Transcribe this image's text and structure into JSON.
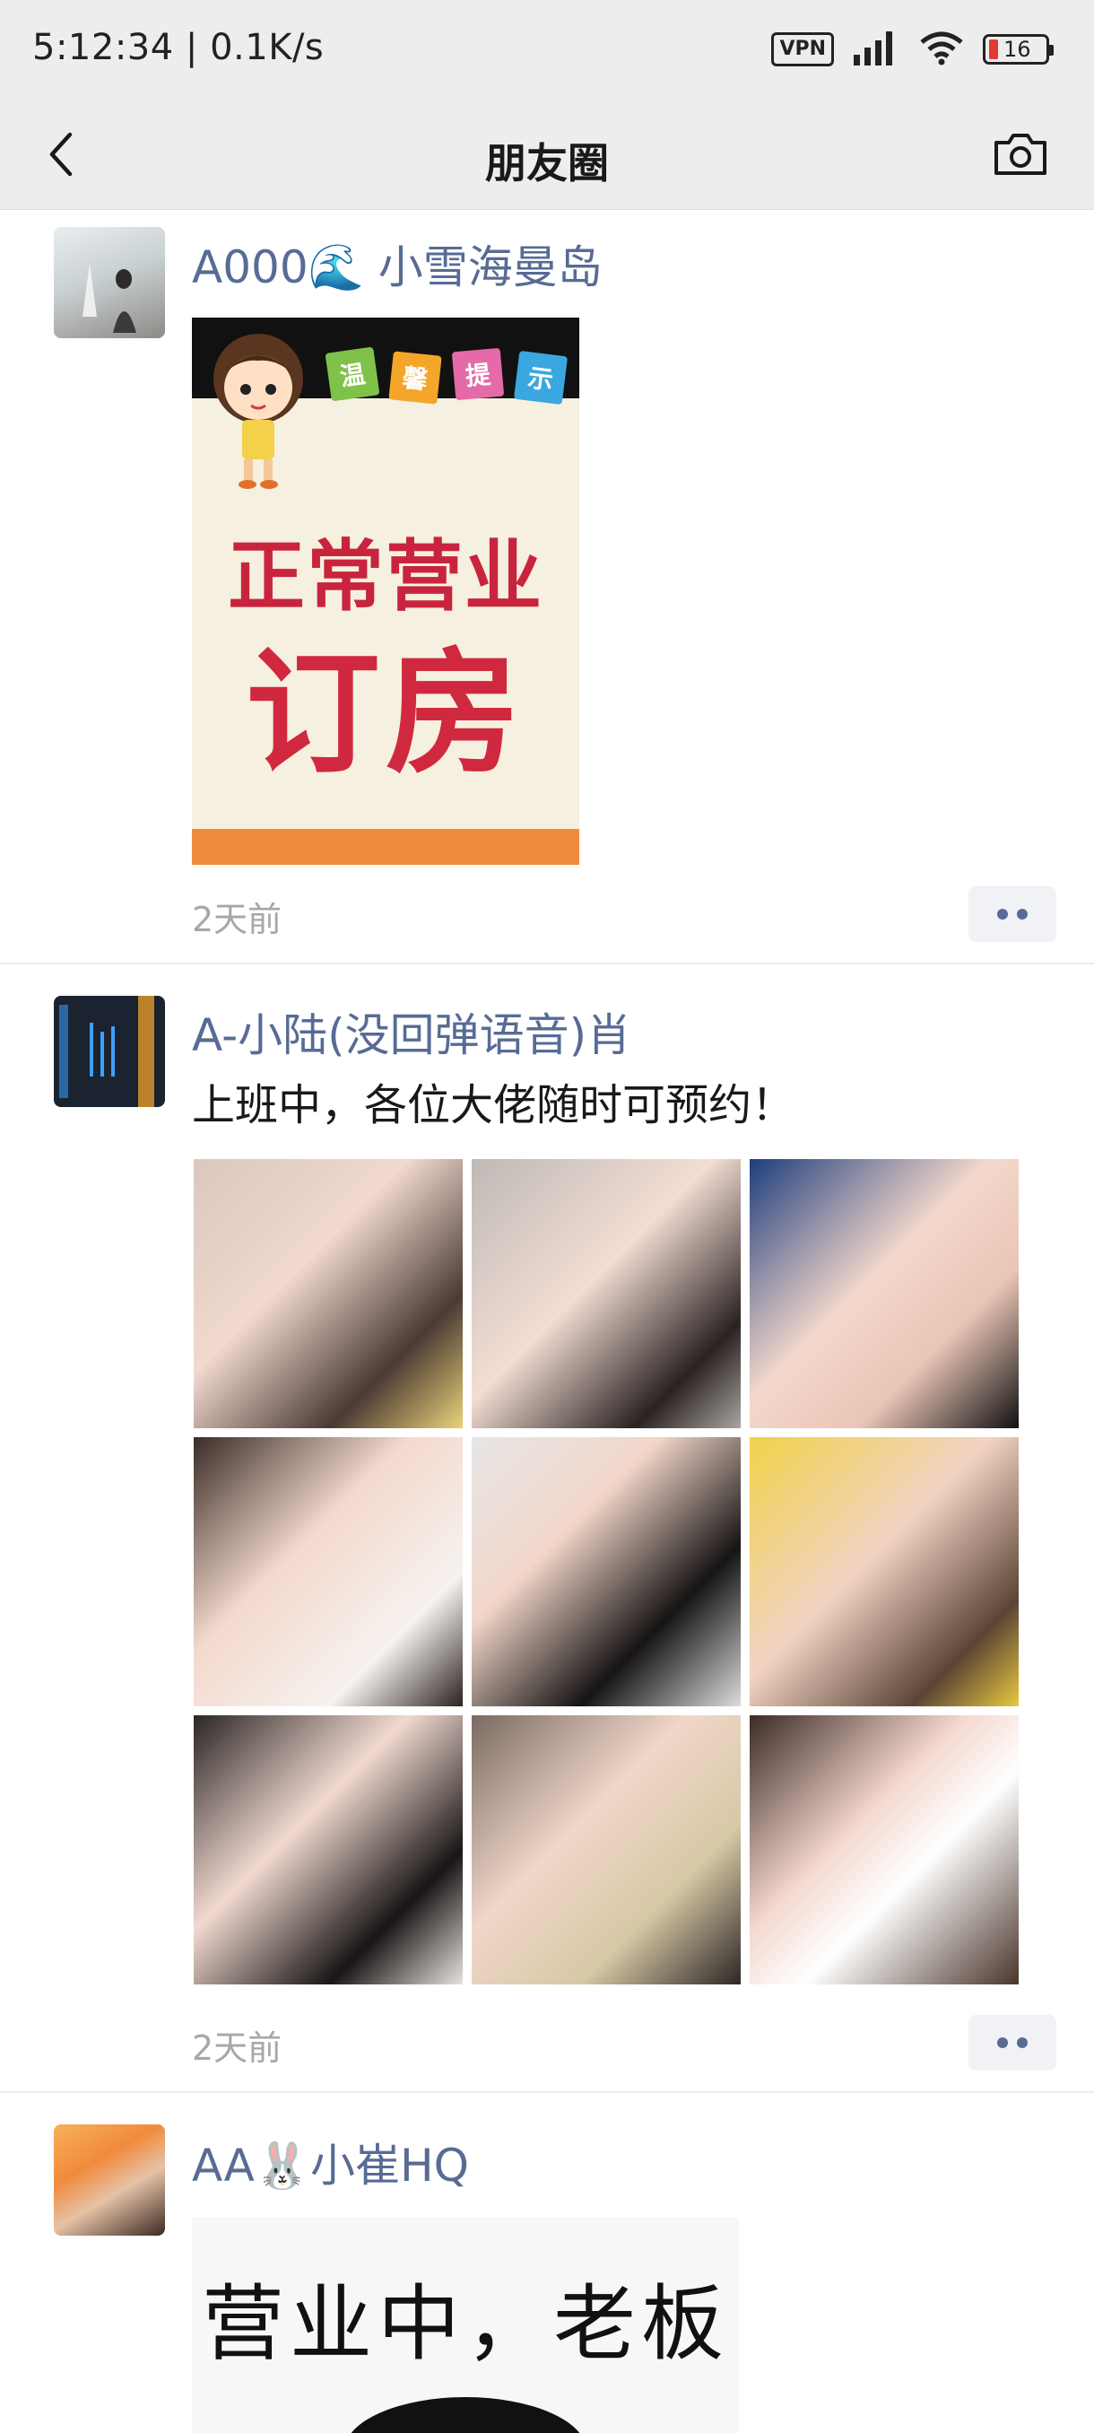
{
  "status_bar": {
    "time": "5:12:34 | 0.1K/s",
    "vpn_label": "VPN",
    "battery_level": "16"
  },
  "header": {
    "title": "朋友圈"
  },
  "posts": [
    {
      "author": "A000🌊  小雪海曼岛",
      "image": {
        "tags": [
          "温",
          "馨",
          "提",
          "示"
        ],
        "line1": "正常营业",
        "line2": "订房"
      },
      "time": "2天前"
    },
    {
      "author": "A-小陆(没回弹语音)肖",
      "text": "上班中，各位大佬随时可预约！",
      "photo_count": 9,
      "time": "2天前"
    },
    {
      "author": "AA🐰小崔HQ",
      "image": {
        "text": "营业中，老板"
      }
    }
  ],
  "colors": {
    "link_blue": "#576b95",
    "header_bg": "#ededed",
    "time_grey": "#a7a7a7"
  }
}
